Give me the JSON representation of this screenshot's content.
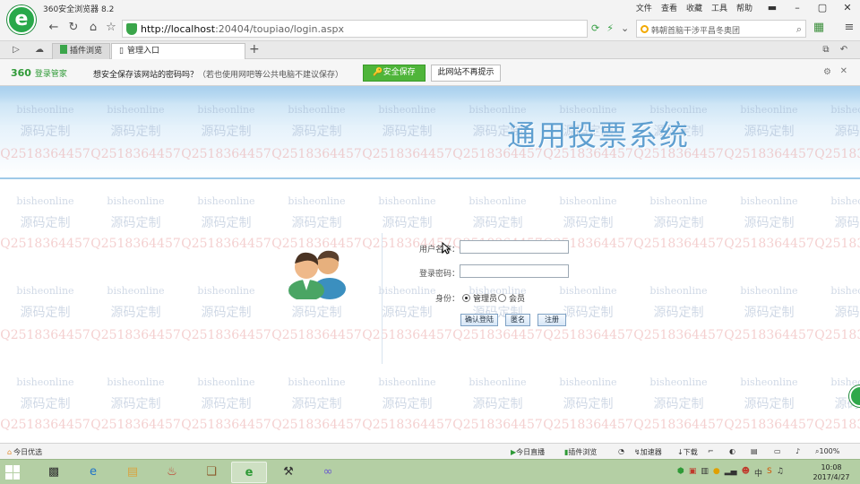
{
  "browser": {
    "title": "360安全浏览器 8.2",
    "menu": [
      "文件",
      "查看",
      "收藏",
      "工具",
      "帮助"
    ],
    "window_buttons": [
      "▬",
      "–",
      "▢",
      "✕"
    ]
  },
  "address": {
    "host": "http://localhost",
    "path": ":20404/toupiao/login.aspx",
    "search_text": "韩朝首脑干涉平昌冬奥团"
  },
  "tabs": {
    "ext_label": "插件浏览",
    "active_label": "管理入口"
  },
  "password_bar": {
    "brand": "360",
    "brand_sub": "登录管家",
    "message": "想安全保存该网站的密码吗？",
    "hint": "（若也使用网吧等公共电脑不建议保存）",
    "save_label": "安全保存",
    "never_label": "此网站不再提示"
  },
  "page": {
    "site_title": "通用投票系统",
    "watermark_line1": "bisheonline",
    "watermark_line2": "源码定制",
    "watermark_line3": "Q2518364457",
    "form": {
      "username_label": "用户名称：",
      "password_label": "登录密码：",
      "role_label": "身份：",
      "role_admin": "管理员",
      "role_member": "会员",
      "btn_login": "确认登陆",
      "btn_anon": "匿名",
      "btn_register": "注册",
      "selected_role": "管理员"
    }
  },
  "status": {
    "left": "今日优选",
    "items": [
      "今日直播",
      "插件浏览",
      "加速器",
      "下载",
      "100%"
    ]
  },
  "taskbar": {
    "time": "10:08",
    "date": "2017/4/27"
  },
  "colors": {
    "accent_green": "#3aa54a",
    "banner_blue": "#5f9fd0",
    "taskbar_green": "#b4cfa4"
  }
}
